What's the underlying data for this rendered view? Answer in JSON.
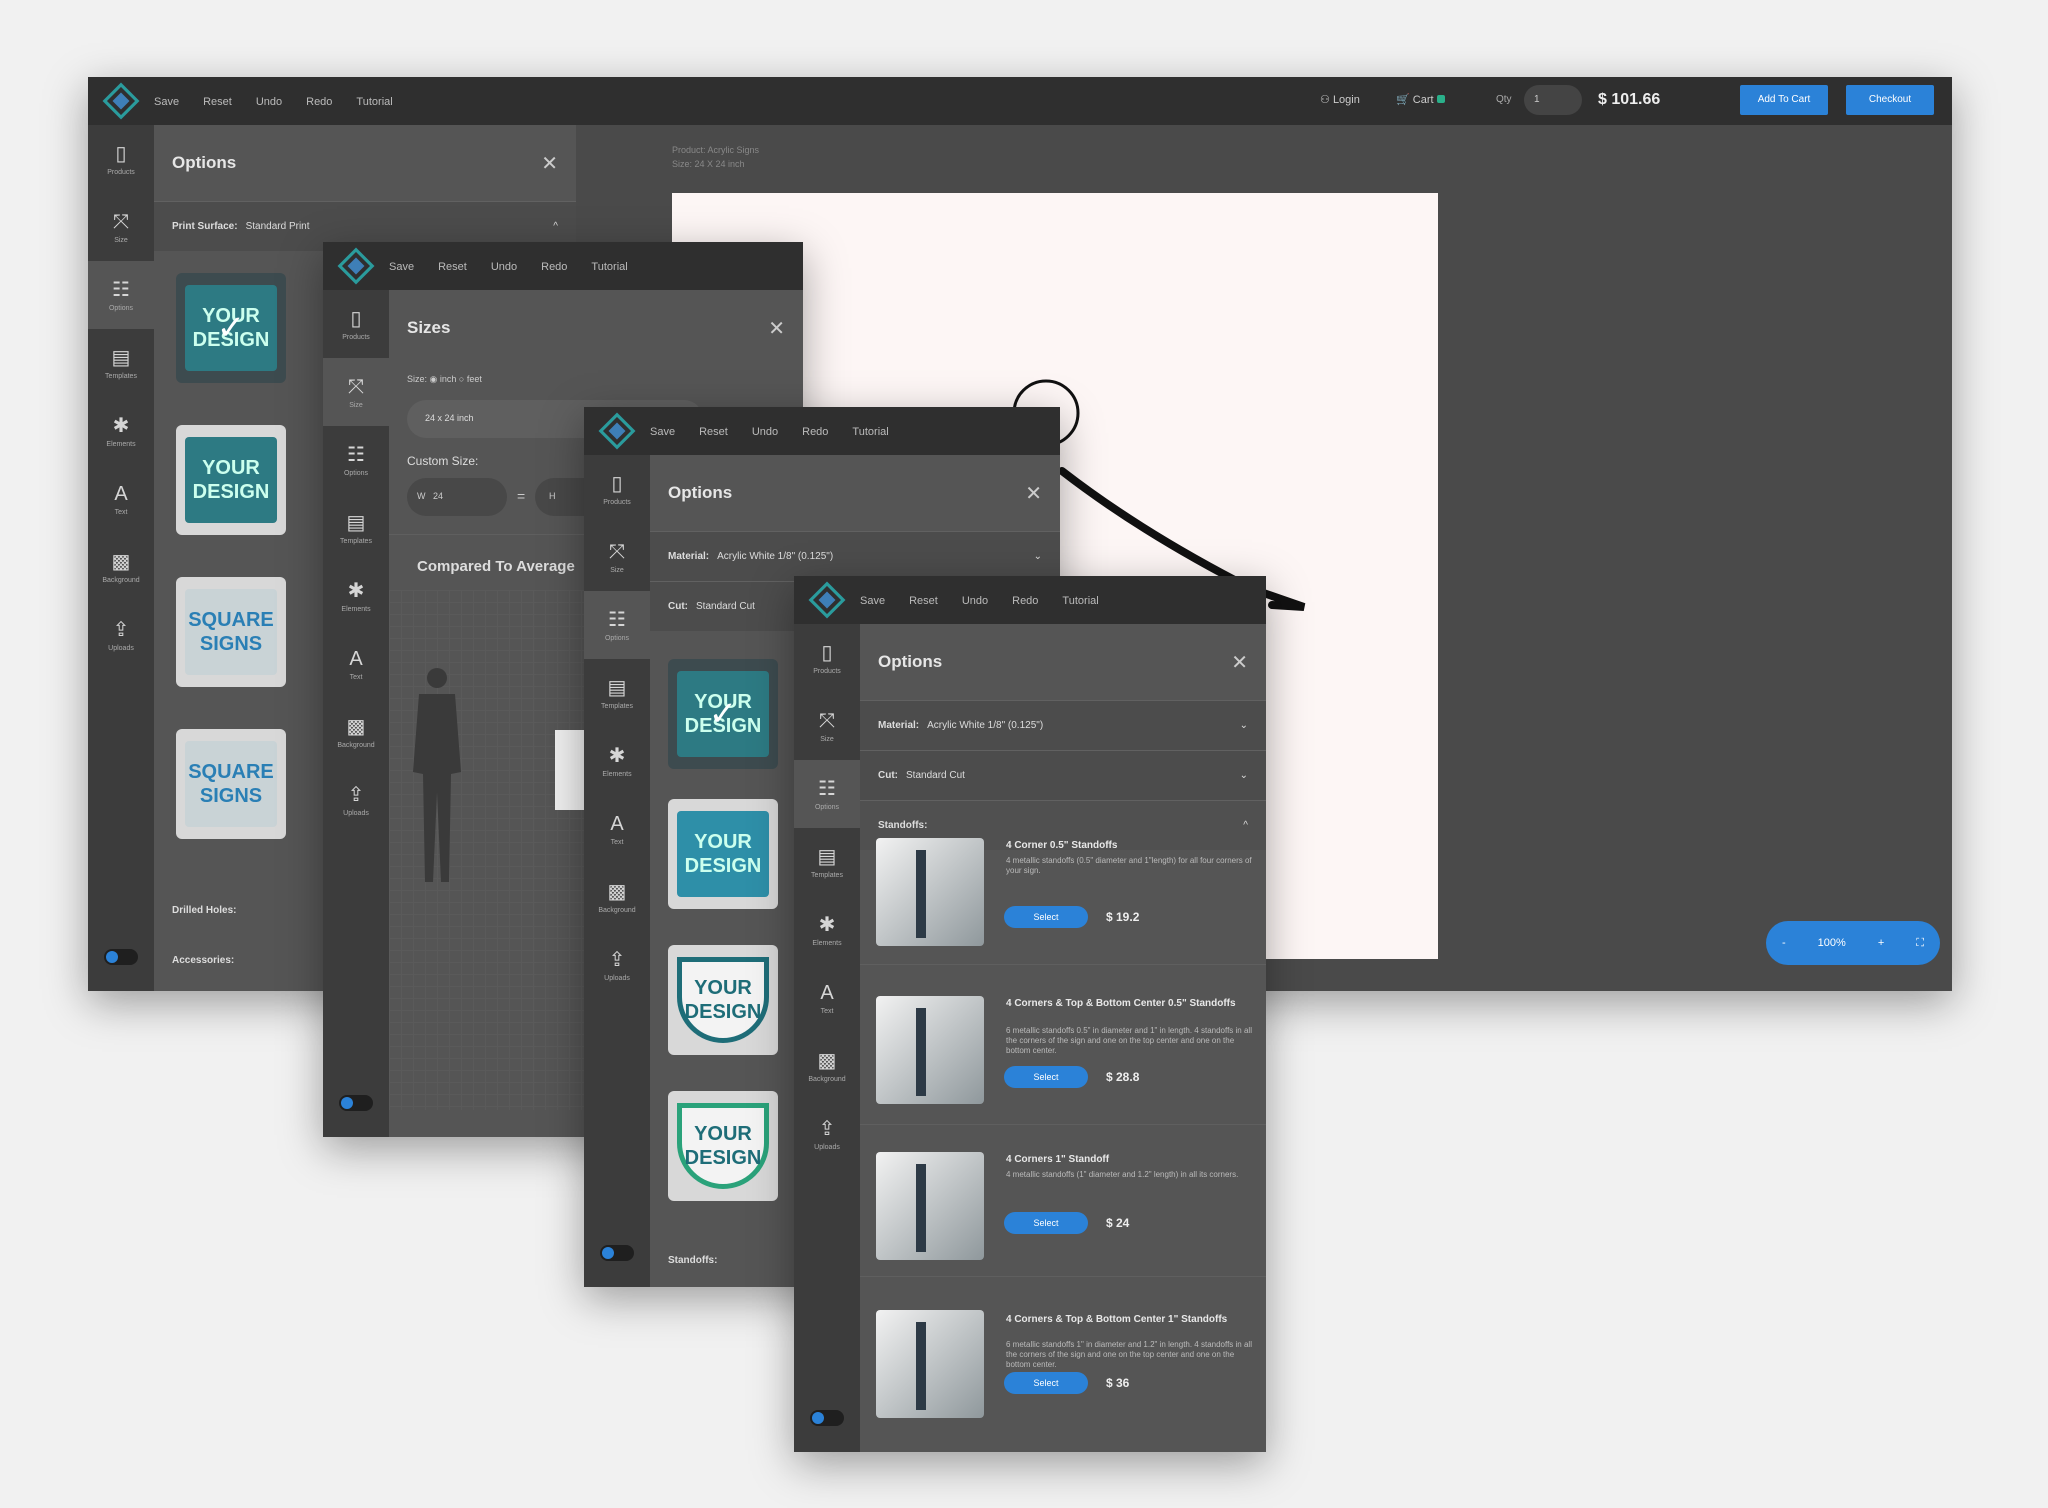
{
  "toolbar": {
    "menu": [
      "Save",
      "Reset",
      "Undo",
      "Redo",
      "Tutorial"
    ],
    "login": "Login",
    "cart": "Cart",
    "qty_label": "Qty",
    "qty_value": "1",
    "total": "$ 101.66",
    "add_to_cart": "Add To Cart",
    "checkout": "Checkout"
  },
  "rail": {
    "items": [
      "Products",
      "Size",
      "Options",
      "Templates",
      "Elements",
      "Text",
      "Background",
      "Uploads"
    ]
  },
  "main_panel": {
    "title": "Options",
    "print_surface_label": "Print Surface:",
    "print_surface_value": "Standard Print",
    "drilled_holes": "Drilled Holes:",
    "accessories": "Accessories:"
  },
  "canvas": {
    "product_label": "Product: Acrylic Signs",
    "size_label": "Size: 24 X 24 inch",
    "zoom": "100%"
  },
  "sizes_panel": {
    "title": "Sizes",
    "unit_label": "Size:",
    "unit_inch": "inch",
    "unit_feet": "feet",
    "preset": "24 x 24 inch",
    "custom_size": "Custom Size:",
    "w_label": "W",
    "w_value": "24",
    "h_label": "H",
    "compare": "Compared To Average"
  },
  "options_panel_3": {
    "title": "Options",
    "material_label": "Material:",
    "material_value": "Acrylic White 1/8\" (0.125\")",
    "cut_label": "Cut:",
    "cut_value": "Standard Cut",
    "standoffs_label": "Standoffs:"
  },
  "options_panel_4": {
    "title": "Options",
    "material_label": "Material:",
    "material_value": "Acrylic White 1/8\" (0.125\")",
    "cut_label": "Cut:",
    "cut_value": "Standard Cut",
    "standoffs_label": "Standoffs:",
    "products": [
      {
        "title": "4 Corner 0.5\" Standoffs",
        "desc": "4 metallic standoffs (0.5\" diameter and 1\"length) for all four corners of your sign.",
        "select": "Select",
        "price": "$ 19.2"
      },
      {
        "title": "4 Corners & Top & Bottom Center 0.5\" Standoffs",
        "desc": "6 metallic standoffs 0.5\" in diameter and 1\" in length. 4 standoffs in all the corners of the sign and one on the top center and one on the bottom center.",
        "select": "Select",
        "price": "$ 28.8"
      },
      {
        "title": "4 Corners 1\" Standoff",
        "desc": "4 metallic standoffs (1\" diameter and 1.2\" length) in all its corners.",
        "select": "Select",
        "price": "$ 24"
      },
      {
        "title": "4 Corners & Top & Bottom Center 1\" Standoffs",
        "desc": "6 metallic standoffs 1\" in diameter and 1.2\" in length. 4 standoffs in all the corners of the sign and one on the top center and one on the bottom center.",
        "select": "Select",
        "price": "$ 36"
      }
    ]
  },
  "designs": {
    "your_design": "YOUR DESIGN",
    "square_signs": "SQUARE SIGNS"
  },
  "colors": {
    "topbar": "#2f2f2f",
    "panel": "#555555",
    "accent": "#2b82d8",
    "teal": "#2d7a83"
  }
}
